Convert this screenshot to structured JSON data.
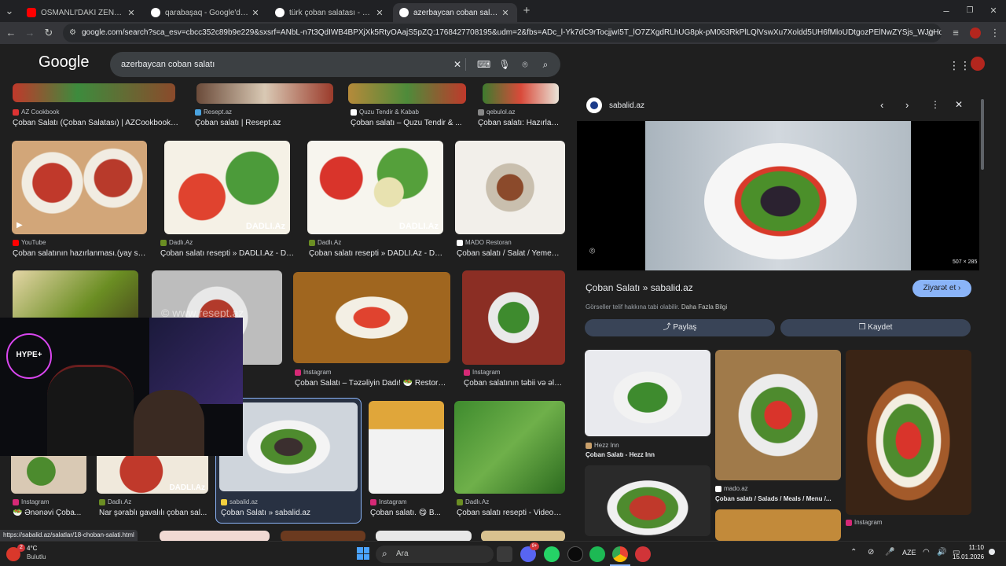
{
  "tabs": [
    {
      "title": "OSMANLI'DAKİ ZENGİN vs. FAKİR",
      "favicon_color": "#ff0000",
      "active": false
    },
    {
      "title": "qarabaşaq - Google'da Ara",
      "favicon_color": "#8ab4f8",
      "active": false
    },
    {
      "title": "türk çoban salatası - Google'da Ara",
      "favicon_color": "#8ab4f8",
      "active": false
    },
    {
      "title": "azerbaycan coban salatı - Google'da Ara",
      "favicon_color": "#8ab4f8",
      "active": true
    }
  ],
  "new_tab_glyph": "+",
  "address_url": "google.com/search?sca_esv=cbcc352c89b9e229&sxsrf=ANbL-n7t3QdIWB4BPXjXk5RtyOAajS5pZQ:1768427708195&udm=2&fbs=ADc_l-Yk7dC9rTocjjwI5T_lO7ZXgdRLhUG8pk-pM063RkPlLQlVswXu7Xoldd5UH6fMloUDtgozPElNwZYSjs_WJgHozC8g597XNU...",
  "google": {
    "logo": "Google",
    "query": "azerbaycan coban salatı"
  },
  "grid_top_row": [
    {
      "source": "AZ Cookbook",
      "title": "Çoban Salatı (Çoban Salatası) | AZCookbook.c..."
    },
    {
      "source": "Resept.az",
      "title": "Çoban salatı | Resept.az"
    },
    {
      "source": "Quzu Tendir & Kabab",
      "title": "Çoban salatı – Quzu Tendir & ..."
    },
    {
      "source": "qebulol.az",
      "title": "Çoban salatı: Hazırlan..."
    }
  ],
  "grid_row2": [
    {
      "source": "YouTube",
      "title": "Çoban salatının hazırlanması.(yay sa..."
    },
    {
      "source": "Dadlı.Az",
      "title": "Çoban salatı resepti » DADLI.Az - Da..."
    },
    {
      "source": "Dadlı.Az",
      "title": "Çoban salatı resepti » DADLI.Az - Da..."
    },
    {
      "source": "MADO Restoran",
      "title": "Çoban salatı / Salat / Yemekl..."
    }
  ],
  "grid_row3": [
    {
      "source": "Instagram",
      "title": "Çoban Salatı – Təzəliyin Dadı! 🥗 Restora..."
    },
    {
      "source": "Instagram",
      "title": "Çoban salatının təbii və əlav..."
    }
  ],
  "watermark_resept": "© www.resept.az",
  "grid_row4": [
    {
      "source": "Instagram",
      "title": "🥗 Ənənəvi Çoba..."
    },
    {
      "source": "Dadlı.Az",
      "title": "Nar şərablı gavalılı çoban sal..."
    },
    {
      "source": "sabalid.az",
      "title": "Çoban Salatı » sabalid.az"
    },
    {
      "source": "Instagram",
      "title": "Çoban salatı. 😋 B..."
    },
    {
      "source": "Dadlı.Az",
      "title": "Çoban salatı resepti - Video r..."
    }
  ],
  "dadli_watermark": "DADLI.Az",
  "panel": {
    "site": "sabalid.az",
    "image_size": "507 × 285",
    "title": "Çoban Salatı » sabalid.az",
    "visit_label": "Ziyarət et",
    "copyright_note": "Görseller telif hakkına tabi olabilir.",
    "more_info": "Daha Fazla Bilgi",
    "share_label": "Paylaş",
    "save_label": "Kaydet",
    "related": [
      {
        "source": "Hezz Inn",
        "title": "Çoban Salatı - Hezz Inn"
      },
      {
        "source": "mado.az",
        "title": "Çoban salatı / Salads / Meals / Menu /..."
      },
      {
        "source": "Instagram",
        "title": ""
      }
    ]
  },
  "webcam": {
    "badge": "HYPE+"
  },
  "status_url": "https://sabalid.az/salatlar/18-choban-salati.html",
  "taskbar": {
    "weather_temp": "4°C",
    "weather_desc": "Bulutlu",
    "weather_badge": "2",
    "search_placeholder": "Ara",
    "language": "AZE",
    "time": "11:10",
    "date": "15.01.2026",
    "discord_badge": "9+"
  }
}
